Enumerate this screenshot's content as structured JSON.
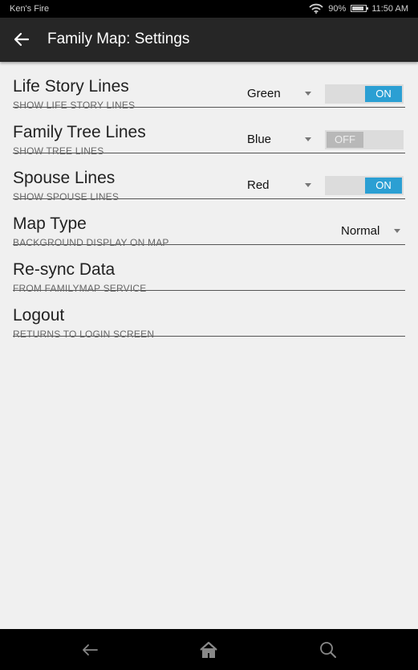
{
  "status_bar": {
    "device_name": "Ken's Fire",
    "battery_percent": "90%",
    "battery_level": 0.9,
    "time": "11:50 AM",
    "icons": [
      "wifi-icon",
      "battery-icon"
    ]
  },
  "app_bar": {
    "title": "Family Map: Settings",
    "back_icon": "arrow-left-icon"
  },
  "settings": [
    {
      "title": "Life Story Lines",
      "subtitle": "SHOW LIFE STORY LINES",
      "dropdown": "Green",
      "toggle": "ON"
    },
    {
      "title": "Family Tree Lines",
      "subtitle": "SHOW TREE LINES",
      "dropdown": "Blue",
      "toggle": "OFF"
    },
    {
      "title": "Spouse Lines",
      "subtitle": "SHOW SPOUSE LINES",
      "dropdown": "Red",
      "toggle": "ON"
    },
    {
      "title": "Map Type",
      "subtitle": "BACKGROUND DISPLAY ON MAP",
      "dropdown": "Normal"
    },
    {
      "title": "Re-sync Data",
      "subtitle": "FROM FAMILYMAP SERVICE"
    },
    {
      "title": "Logout",
      "subtitle": "RETURNS TO LOGIN SCREEN"
    }
  ],
  "nav_bar": {
    "icons": [
      "back-icon",
      "home-icon",
      "search-icon"
    ]
  },
  "colors": {
    "accent": "#2b9fd3",
    "app_bar": "#262626",
    "background": "#f0f0f0"
  }
}
